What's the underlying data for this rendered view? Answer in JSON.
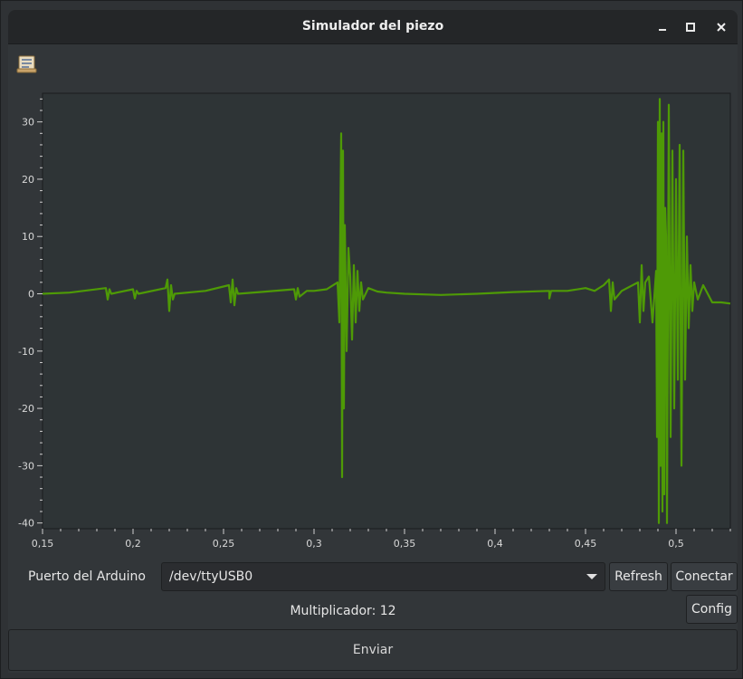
{
  "window": {
    "title": "Simulador del piezo",
    "controls": [
      "minimize",
      "maximize",
      "close"
    ]
  },
  "toolbar": {
    "icon": "save-log-icon"
  },
  "chart_data": {
    "type": "line",
    "title": "",
    "xlabel": "",
    "ylabel": "",
    "xlim": [
      0.15,
      0.53
    ],
    "ylim": [
      -41,
      35
    ],
    "xticks": [
      0.15,
      0.2,
      0.25,
      0.3,
      0.35,
      0.4,
      0.45,
      0.5
    ],
    "xtick_labels": [
      "0,15",
      "0,2",
      "0,25",
      "0,3",
      "0,35",
      "0,4",
      "0,45",
      "0,5"
    ],
    "yticks": [
      30,
      20,
      10,
      0,
      -10,
      -20,
      -30,
      -40
    ],
    "ytick_labels": [
      "30",
      "20",
      "10",
      "0",
      "-10",
      "-20",
      "-30",
      "-40"
    ],
    "line_color": "#4e9a06",
    "background": "#2e3436",
    "grid": false,
    "series": [
      {
        "name": "",
        "x": [
          0.15,
          0.165,
          0.185,
          0.186,
          0.187,
          0.188,
          0.2,
          0.201,
          0.202,
          0.203,
          0.218,
          0.219,
          0.22,
          0.221,
          0.222,
          0.223,
          0.24,
          0.253,
          0.254,
          0.255,
          0.256,
          0.257,
          0.258,
          0.27,
          0.289,
          0.29,
          0.291,
          0.292,
          0.296,
          0.3,
          0.307,
          0.313,
          0.314,
          0.315,
          0.3155,
          0.316,
          0.3165,
          0.317,
          0.318,
          0.319,
          0.32,
          0.321,
          0.322,
          0.323,
          0.324,
          0.325,
          0.326,
          0.327,
          0.33,
          0.335,
          0.34,
          0.35,
          0.37,
          0.39,
          0.41,
          0.43,
          0.43,
          0.431,
          0.44,
          0.45,
          0.455,
          0.46,
          0.463,
          0.464,
          0.465,
          0.466,
          0.47,
          0.479,
          0.48,
          0.481,
          0.482,
          0.483,
          0.485,
          0.487,
          0.489,
          0.4895,
          0.49,
          0.4905,
          0.491,
          0.4915,
          0.492,
          0.4925,
          0.493,
          0.4935,
          0.494,
          0.4945,
          0.495,
          0.496,
          0.497,
          0.498,
          0.499,
          0.5,
          0.501,
          0.502,
          0.503,
          0.504,
          0.505,
          0.506,
          0.507,
          0.508,
          0.509,
          0.51,
          0.512,
          0.515,
          0.52,
          0.525,
          0.53
        ],
        "y": [
          0,
          0.2,
          1,
          -1,
          0.8,
          0,
          0.8,
          -0.8,
          0.5,
          0,
          1,
          2.5,
          -3,
          1.5,
          -1,
          0,
          0.5,
          1.5,
          -1.5,
          2.5,
          -2,
          1,
          0,
          0.3,
          0.8,
          -1,
          1,
          -0.5,
          0.5,
          0.5,
          0.8,
          2,
          -5,
          28,
          -32,
          25,
          -20,
          12,
          -10,
          8,
          3,
          -8,
          5,
          -5,
          4,
          -3,
          2,
          -1,
          1,
          0.4,
          0.2,
          0,
          -0.2,
          0,
          0.3,
          0.5,
          -0.8,
          0.5,
          0.5,
          1,
          0.5,
          1.5,
          2.5,
          -3,
          2,
          -1,
          0.5,
          2,
          -5,
          5,
          -3,
          2,
          3,
          -5,
          4,
          -25,
          30,
          -40,
          34,
          -30,
          28,
          -38,
          30,
          -35,
          15,
          10,
          -40,
          33,
          -25,
          25,
          -20,
          20,
          -15,
          26,
          -30,
          25,
          -15,
          10,
          -6,
          5,
          -3,
          2,
          -1,
          1.5,
          -1.5,
          -1.5,
          -1.7
        ]
      }
    ]
  },
  "controls": {
    "port_label": "Puerto del Arduino",
    "port_value": "/dev/ttyUSB0",
    "refresh_label": "Refresh",
    "connect_label": "Conectar",
    "multiplier_text": "Multiplicador: 12",
    "config_label": "Config",
    "send_label": "Enviar"
  }
}
